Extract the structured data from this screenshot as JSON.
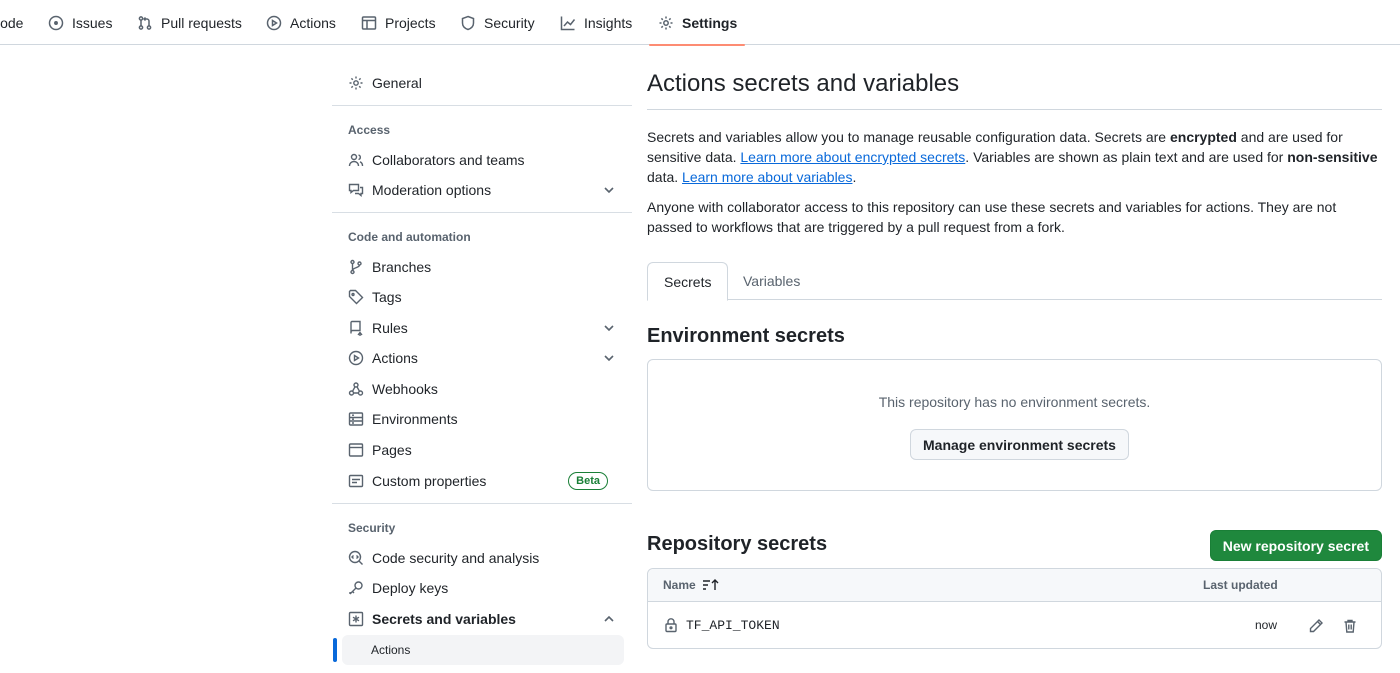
{
  "repo_nav": {
    "tabs": [
      {
        "label": "Code",
        "icon": "code-icon"
      },
      {
        "label": "Issues",
        "icon": "issue-opened-icon"
      },
      {
        "label": "Pull requests",
        "icon": "git-pull-request-icon"
      },
      {
        "label": "Actions",
        "icon": "play-icon"
      },
      {
        "label": "Projects",
        "icon": "table-icon"
      },
      {
        "label": "Security",
        "icon": "shield-icon"
      },
      {
        "label": "Insights",
        "icon": "graph-icon"
      },
      {
        "label": "Settings",
        "icon": "gear-icon",
        "active": true
      }
    ]
  },
  "sidebar": {
    "general": "General",
    "access_heading": "Access",
    "access_items": [
      "Collaborators and teams",
      "Moderation options"
    ],
    "code_heading": "Code and automation",
    "code_items": [
      "Branches",
      "Tags",
      "Rules",
      "Actions",
      "Webhooks",
      "Environments",
      "Pages",
      "Custom properties"
    ],
    "beta_badge": "Beta",
    "security_heading": "Security",
    "security_items": [
      "Code security and analysis",
      "Deploy keys",
      "Secrets and variables"
    ],
    "secrets_sub_items": [
      "Actions"
    ]
  },
  "main": {
    "title": "Actions secrets and variables",
    "intro": {
      "part1": "Secrets and variables allow you to manage reusable configuration data. Secrets are ",
      "encrypted": "encrypted",
      "part2": " and are used for sensitive data. ",
      "link_secrets": "Learn more about encrypted secrets",
      "part3": ". Variables are shown as plain text and are used for ",
      "non_sensitive": "non-sensitive",
      "part4": " data. ",
      "link_variables": "Learn more about variables",
      "part5": "."
    },
    "access_note": "Anyone with collaborator access to this repository can use these secrets and variables for actions. They are not passed to workflows that are triggered by a pull request from a fork.",
    "tabs": [
      {
        "label": "Secrets",
        "active": true
      },
      {
        "label": "Variables",
        "active": false
      }
    ],
    "environment_secrets": {
      "title": "Environment secrets",
      "empty_text": "This repository has no environment secrets.",
      "manage_button": "Manage environment secrets"
    },
    "repository_secrets": {
      "title": "Repository secrets",
      "new_button": "New repository secret",
      "columns": {
        "name": "Name",
        "last_updated": "Last updated"
      },
      "rows": [
        {
          "name": "TF_API_TOKEN",
          "last_updated": "now"
        }
      ]
    }
  },
  "colors": {
    "accent_link": "#0969da",
    "primary_button": "#1f883d",
    "active_tab_underline": "#fd8c73",
    "beta_green": "#1a7f37"
  }
}
